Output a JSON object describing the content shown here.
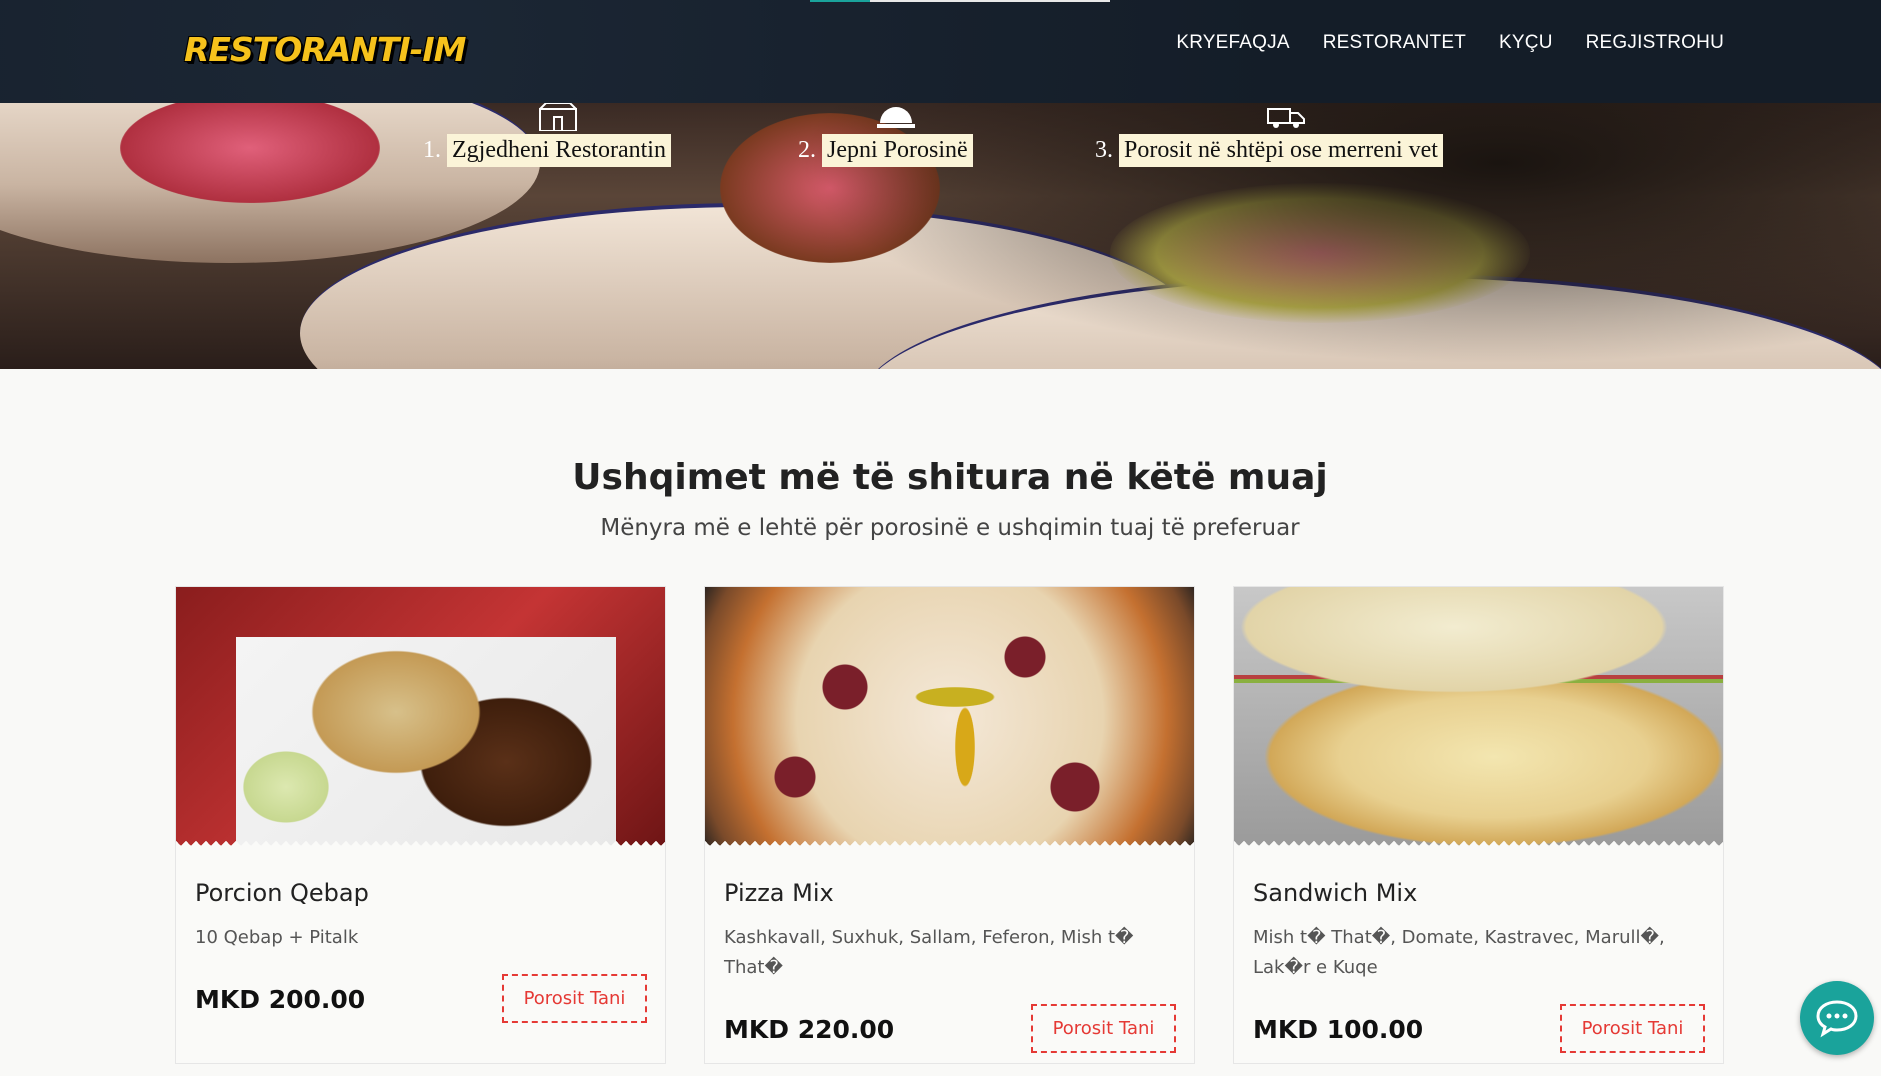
{
  "header": {
    "logo": "RESTORANTI-IM",
    "nav": [
      "KRYEFAQJA",
      "RESTORANTET",
      "KYÇU",
      "REGJISTROHU"
    ]
  },
  "hero": {
    "steps": [
      {
        "num": "1.",
        "text": "Zgjedheni Restorantin",
        "icon": "store-icon"
      },
      {
        "num": "2.",
        "text": "Jepni Porosinë",
        "icon": "cloche-icon"
      },
      {
        "num": "3.",
        "text": "Porosit në shtëpi ose merreni vet",
        "icon": "delivery-truck-icon"
      }
    ]
  },
  "section": {
    "title": "Ushqimet më të shitura në këtë muaj",
    "subtitle": "Mënyra më e lehtë për porosinë e ushqimin tuaj të preferuar"
  },
  "products": [
    {
      "name": "Porcion Qebap",
      "desc": "10 Qebap + Pitalk",
      "price": "MKD 200.00",
      "button": "Porosit Tani"
    },
    {
      "name": "Pizza Mix",
      "desc": "Kashkavall, Suxhuk, Sallam, Feferon, Mish t� That�",
      "price": "MKD 220.00",
      "button": "Porosit Tani"
    },
    {
      "name": "Sandwich Mix",
      "desc": "Mish t� That�, Domate, Kastravec, Marull�, Lak�r e Kuqe",
      "price": "MKD 100.00",
      "button": "Porosit Tani"
    }
  ],
  "colors": {
    "accent": "#e53935",
    "chat": "#1aa39b",
    "header": "#141d28",
    "logo": "#f6c21c"
  }
}
